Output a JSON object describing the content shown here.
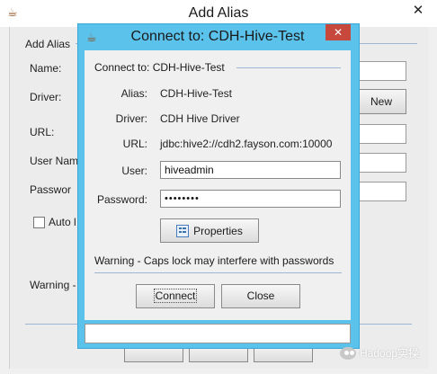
{
  "background_window": {
    "title": "Add Alias",
    "close_glyph": "✕",
    "group_title": "Add Alias",
    "labels": {
      "name": "Name:",
      "driver": "Driver:",
      "url": "URL:",
      "user_name": "User Nam",
      "password": "Passwor",
      "auto_logon": "Auto l",
      "warning": "Warning -"
    },
    "new_button": "New"
  },
  "dialog": {
    "title": "Connect to: CDH-Hive-Test",
    "close_glyph": "✕",
    "section_title": "Connect to: CDH-Hive-Test",
    "alias_label": "Alias:",
    "alias_value": "CDH-Hive-Test",
    "driver_label": "Driver:",
    "driver_value": "CDH Hive Driver",
    "url_label": "URL:",
    "url_value": "jdbc:hive2://cdh2.fayson.com:10000",
    "user_label": "User:",
    "user_value": "hiveadmin",
    "password_label": "Password:",
    "password_value": "••••••••",
    "properties_button": "Properties",
    "warning_text": "Warning - Caps lock may interfere with passwords",
    "connect_button": "Connect",
    "close_button": "Close",
    "status_text": ""
  },
  "watermark": {
    "text": "Hadoop实操"
  },
  "icons": {
    "app_icon": "coffee-bean-icon",
    "properties_icon": "properties-sheet-icon",
    "watermark_icon": "wechat-icon"
  },
  "colors": {
    "dialog_frame": "#5bc2ec",
    "close_button": "#c7483d",
    "divider": "#9fb6d2"
  }
}
